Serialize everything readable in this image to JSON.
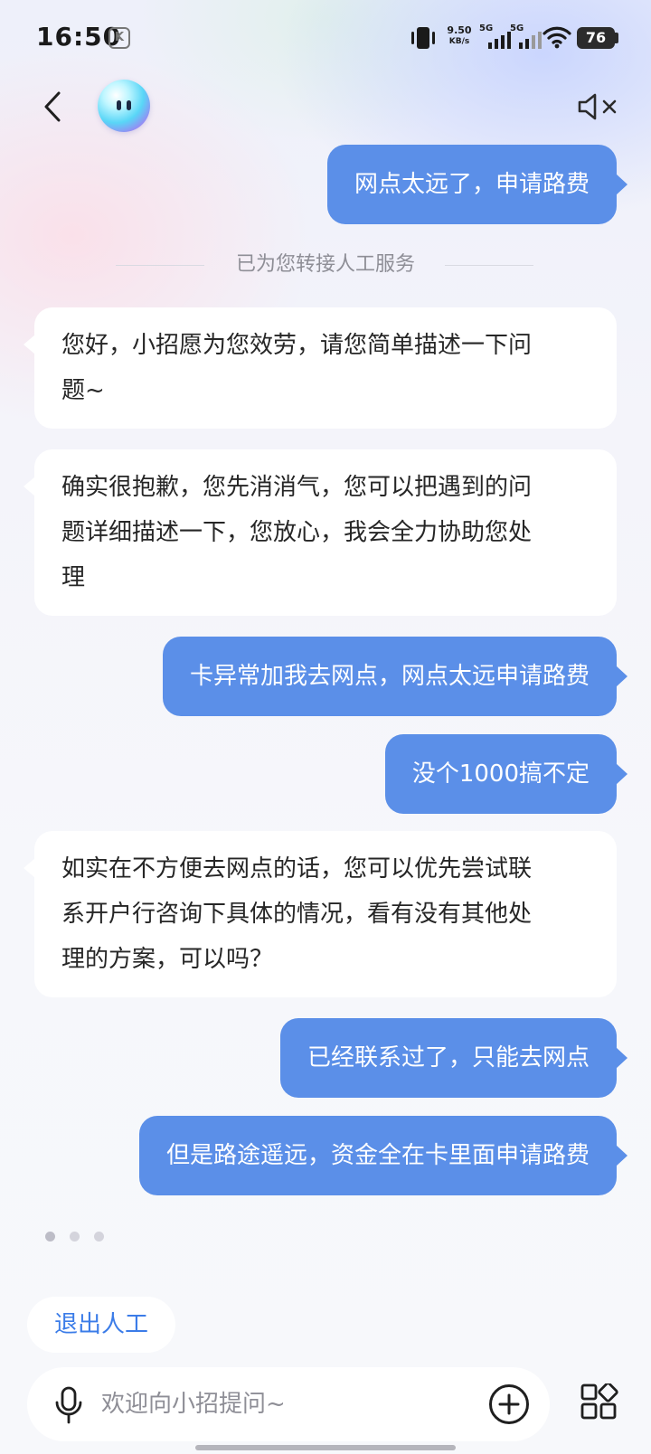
{
  "status_bar": {
    "time": "16:50",
    "kb_badge": "K",
    "net_speed_value": "9.50",
    "net_speed_unit": "KB/s",
    "sim1": "5G",
    "sim2": "5G",
    "battery": "76"
  },
  "header": {
    "back_icon": "chevron-left-icon",
    "avatar_icon": "assistant-avatar",
    "mute_icon": "speaker-muted-icon"
  },
  "chat": {
    "transfer_notice": "已为您转接人工服务",
    "messages": [
      {
        "role": "user",
        "text": "网点太远了，申请路费"
      },
      {
        "role": "agent",
        "lines": [
          "您好，小招愿为您效劳，请您简单描述一下问",
          "题~"
        ]
      },
      {
        "role": "agent",
        "lines": [
          "确实很抱歉，您先消消气，您可以把遇到的问",
          "题详细描述一下，您放心，我会全力协助您处",
          "理"
        ]
      },
      {
        "role": "user",
        "text": "卡异常加我去网点，网点太远申请路费"
      },
      {
        "role": "user",
        "text": "没个1000搞不定"
      },
      {
        "role": "agent",
        "lines": [
          "如实在不方便去网点的话，您可以优先尝试联",
          "系开户行咨询下具体的情况，看有没有其他处",
          "理的方案，可以吗？"
        ]
      },
      {
        "role": "user",
        "text": "已经联系过了，只能去网点"
      },
      {
        "role": "user",
        "text": "但是路途遥远，资金全在卡里面申请路费"
      }
    ]
  },
  "footer": {
    "exit_button_label": "退出人工",
    "input_placeholder": "欢迎向小招提问~",
    "mic_icon": "microphone-icon",
    "plus_icon": "plus-circle-icon",
    "apps_icon": "apps-grid-icon"
  },
  "colors": {
    "user_bubble": "#5b8fe8",
    "agent_bubble": "#ffffff",
    "accent_text": "#3b7ce8"
  }
}
